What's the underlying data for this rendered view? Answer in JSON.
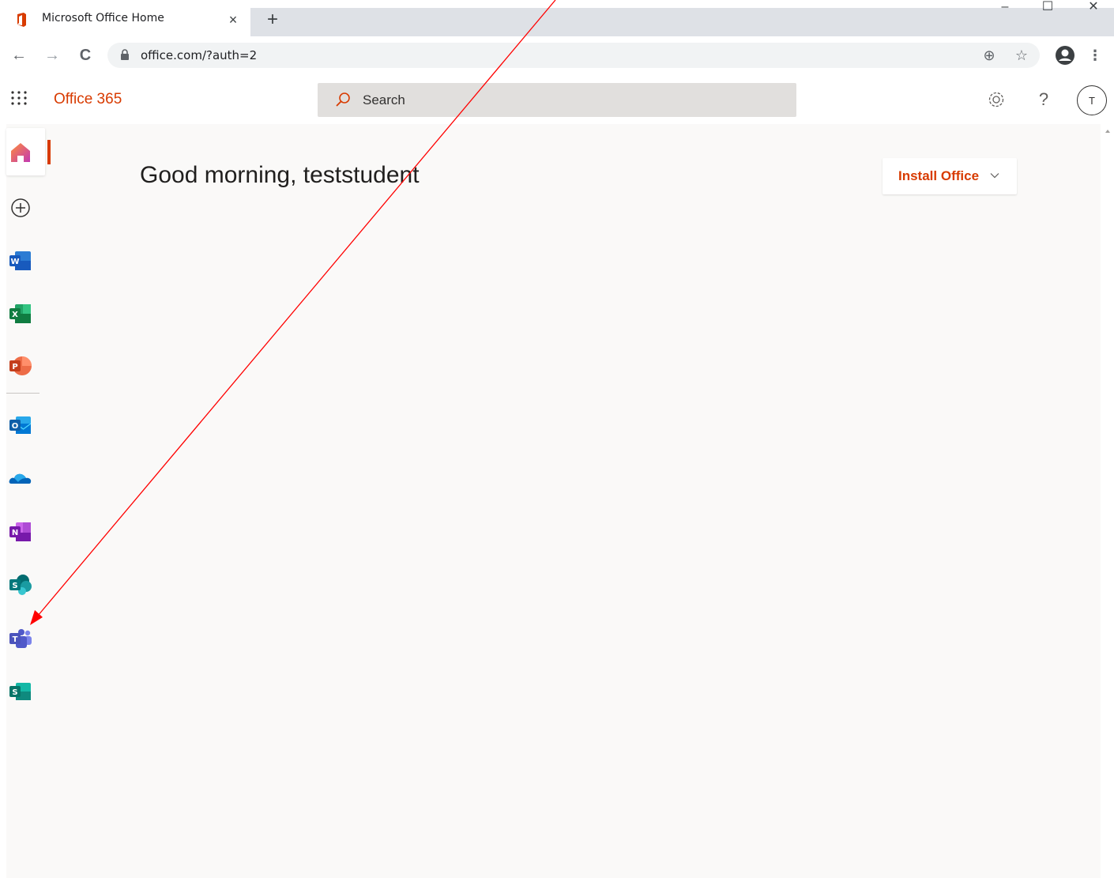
{
  "browser": {
    "tab_title": "Microsoft Office Home",
    "tab_close_glyph": "×",
    "new_tab_glyph": "+",
    "window_controls": [
      "–",
      "☐",
      "✕"
    ],
    "url": "office.com/?auth=2",
    "back_glyph": "←",
    "forward_glyph": "→",
    "reload_glyph": "C",
    "add_glyph": "⊕",
    "star_glyph": "☆",
    "menu_glyph": "⋮"
  },
  "header": {
    "brand": "Office 365",
    "search_placeholder": "Search",
    "help_glyph": "?",
    "avatar_initial": "T"
  },
  "rail": {
    "items": [
      {
        "name": "Home",
        "icon": "home-icon"
      },
      {
        "name": "Create",
        "icon": "plus-circle-icon"
      },
      {
        "name": "Word",
        "icon": "word-icon",
        "letter": "W"
      },
      {
        "name": "Excel",
        "icon": "excel-icon",
        "letter": "X"
      },
      {
        "name": "PowerPoint",
        "icon": "powerpoint-icon",
        "letter": "P"
      },
      {
        "name": "Outlook",
        "icon": "outlook-icon",
        "letter": "O"
      },
      {
        "name": "OneDrive",
        "icon": "onedrive-icon"
      },
      {
        "name": "OneNote",
        "icon": "onenote-icon",
        "letter": "N"
      },
      {
        "name": "SharePoint",
        "icon": "sharepoint-icon",
        "letter": "S"
      },
      {
        "name": "Teams",
        "icon": "teams-icon",
        "letter": "T"
      },
      {
        "name": "Sway",
        "icon": "sway-icon",
        "letter": "S"
      }
    ]
  },
  "main": {
    "greeting": "Good morning, teststudent",
    "install_label": "Install Office"
  },
  "colors": {
    "brand_orange": "#d83b01",
    "canvas": "#faf9f8",
    "annotation_arrow": "#ff0000"
  }
}
